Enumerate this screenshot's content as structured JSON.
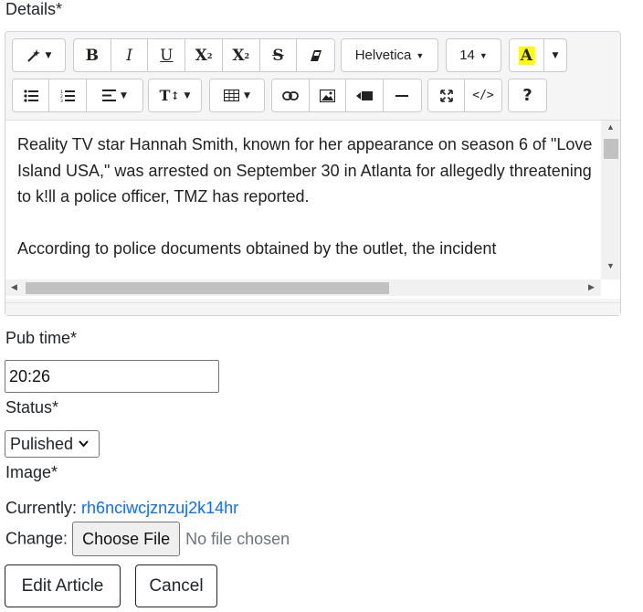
{
  "labels": {
    "details": "Details*",
    "pub_time": "Pub time*",
    "status": "Status*",
    "image": "Image*",
    "currently": "Currently:",
    "change": "Change:"
  },
  "toolbar": {
    "bold": "B",
    "italic": "I",
    "underline": "U",
    "superscript": "X",
    "subscript": "X",
    "strikethrough": "S",
    "font_family": "Helvetica",
    "font_size": "14",
    "color_letter": "A",
    "fontsize_tool": "T",
    "codeview": "</>",
    "help": "?"
  },
  "editor": {
    "paragraphs": [
      "Reality TV star Hannah Smith, known for her appearance on season 6 of \"Love Island USA,\" was arrested on September 30 in Atlanta for allegedly threatening to k!ll a police officer, TMZ has reported.",
      "According to police documents obtained by the outlet, the incident"
    ]
  },
  "pub_time": {
    "value": "20:26"
  },
  "status": {
    "selected": "Pulished"
  },
  "image": {
    "current_file": "rh6nciwcjznzuj2k14hr",
    "choose_label": "Choose File",
    "no_file": "No file chosen"
  },
  "actions": {
    "edit": "Edit Article",
    "cancel": "Cancel"
  },
  "colors": {
    "link": "#0d6efd",
    "highlight": "#ffff00"
  }
}
